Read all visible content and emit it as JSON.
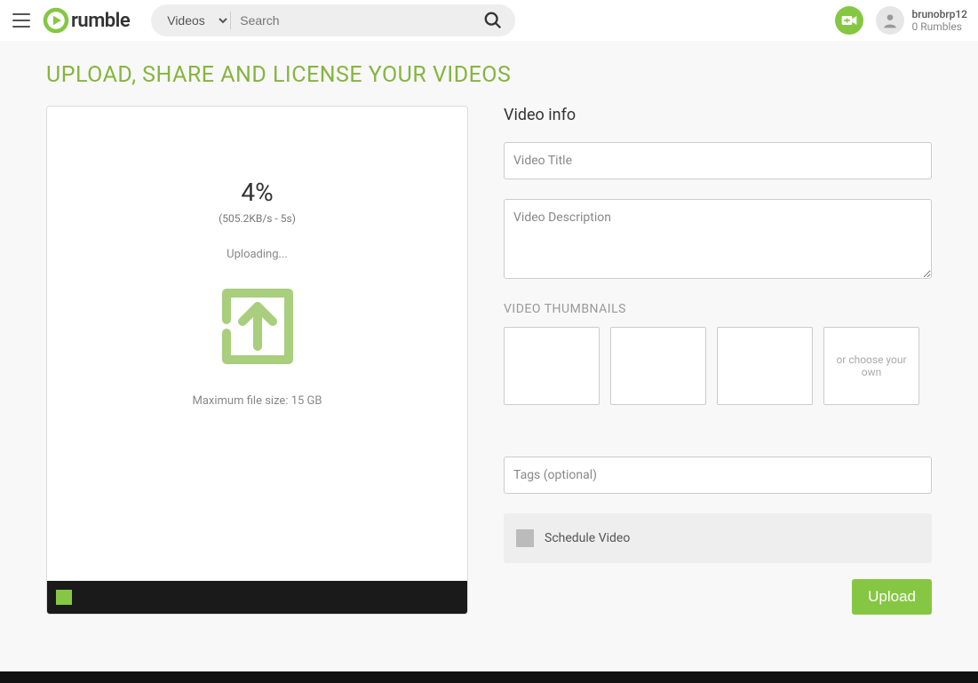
{
  "header": {
    "logo_text": "rumble",
    "search_type": "Videos",
    "search_placeholder": "Search"
  },
  "user": {
    "name": "brunobrp12",
    "rumbles": "0 Rumbles"
  },
  "page": {
    "title": "UPLOAD, SHARE AND LICENSE YOUR VIDEOS"
  },
  "upload": {
    "percent": "4%",
    "speed": "(505.2KB/s - 5s)",
    "status": "Uploading...",
    "max_file": "Maximum file size: 15 GB"
  },
  "info": {
    "section_title": "Video info",
    "title_placeholder": "Video Title",
    "desc_placeholder": "Video Description",
    "thumbs_label": "VIDEO THUMBNAILS",
    "choose_own": "or choose your own",
    "tags_placeholder": "Tags (optional)",
    "schedule_label": "Schedule Video",
    "upload_btn": "Upload"
  }
}
